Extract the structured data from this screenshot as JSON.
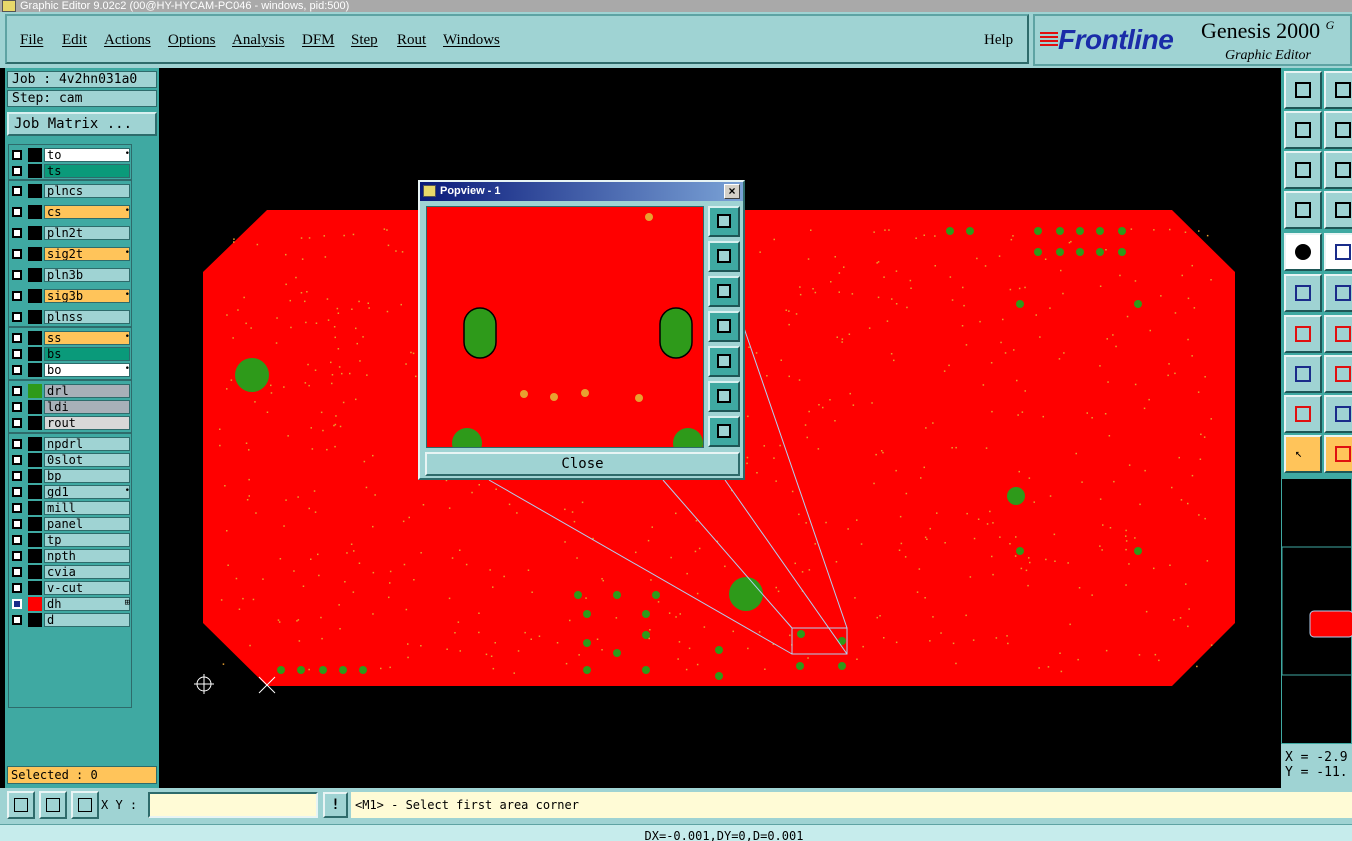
{
  "window": {
    "title": "Graphic Editor 9.02c2 (00@HY-HYCAM-PC046 - windows, pid:500)"
  },
  "menu": [
    "File",
    "Edit",
    "Actions",
    "Options",
    "Analysis",
    "DFM",
    "Step",
    "Rout",
    "Windows"
  ],
  "help_label": "Help",
  "logo": {
    "brand": "Frontline",
    "product": "Genesis 2000",
    "version_fragment": "G",
    "subtitle": "Graphic Editor"
  },
  "job": {
    "job_label": "Job : 4v2hn031a0",
    "step_label": "Step: cam",
    "matrix_button": "Job Matrix ..."
  },
  "layers": [
    {
      "name": "to",
      "color": "#ffffff",
      "marker": "•"
    },
    {
      "name": "ts",
      "color": "#0a9a7a",
      "marker": ""
    },
    {
      "name": "plncs",
      "color": "#9fd3d3",
      "marker": ""
    },
    {
      "name": "cs",
      "color": "#ffc45a",
      "marker": "•"
    },
    {
      "name": "pln2t",
      "color": "#9fd3d3",
      "marker": ""
    },
    {
      "name": "sig2t",
      "color": "#ffc45a",
      "marker": "•"
    },
    {
      "name": "pln3b",
      "color": "#9fd3d3",
      "marker": ""
    },
    {
      "name": "sig3b",
      "color": "#ffc45a",
      "marker": "•"
    },
    {
      "name": "plnss",
      "color": "#9fd3d3",
      "marker": ""
    },
    {
      "name": "ss",
      "color": "#ffc45a",
      "marker": "•"
    },
    {
      "name": "bs",
      "color": "#0a9a7a",
      "marker": ""
    },
    {
      "name": "bo",
      "color": "#ffffff",
      "marker": "•"
    },
    {
      "name": "drl",
      "color": "#a8b0b8",
      "marker": ""
    },
    {
      "name": "ldi",
      "color": "#a8b0b8",
      "marker": ""
    },
    {
      "name": "rout",
      "color": "#d8d8d8",
      "marker": ""
    },
    {
      "name": "npdrl",
      "color": "#9fd3d3",
      "marker": ""
    },
    {
      "name": "0slot",
      "color": "#9fd3d3",
      "marker": ""
    },
    {
      "name": "bp",
      "color": "#9fd3d3",
      "marker": ""
    },
    {
      "name": "gd1",
      "color": "#9fd3d3",
      "marker": "•"
    },
    {
      "name": "mill",
      "color": "#9fd3d3",
      "marker": ""
    },
    {
      "name": "panel",
      "color": "#9fd3d3",
      "marker": ""
    },
    {
      "name": "tp",
      "color": "#9fd3d3",
      "marker": ""
    },
    {
      "name": "npth",
      "color": "#9fd3d3",
      "marker": ""
    },
    {
      "name": "cvia",
      "color": "#9fd3d3",
      "marker": ""
    },
    {
      "name": "v-cut",
      "color": "#9fd3d3",
      "marker": ""
    },
    {
      "name": "dh",
      "color": "#9fd3d3",
      "marker": "⊞",
      "active": true
    },
    {
      "name": "d",
      "color": "#9fd3d3",
      "marker": ""
    }
  ],
  "selected_label": "Selected : 0",
  "popview": {
    "title": "Popview - 1",
    "close_label": "Close"
  },
  "coords": {
    "x_label": "X = -2.9",
    "y_label": "Y = -11."
  },
  "xy_label": "X Y :",
  "xy_value": "",
  "excl_label": "!",
  "prompt": "<M1> - Select first area corner",
  "status": "DX=-0.001,DY=0,D=0.001",
  "colors": {
    "board": "#ff0000",
    "pad": "#2e9a1a",
    "via": "#e8a030",
    "panel": "#9fd3d3",
    "accent": "#3fa9a2"
  }
}
